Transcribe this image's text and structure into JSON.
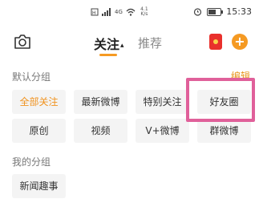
{
  "status_bar": {
    "network": "4G",
    "speed": "4.1",
    "speed_unit": "K/s",
    "time": "15:33"
  },
  "header": {
    "tab_follow": "关注",
    "tab_recommend": "推荐"
  },
  "groups": {
    "default_label": "默认分组",
    "edit_label": "编辑",
    "default_chips": [
      "全部关注",
      "最新微博",
      "特别关注",
      "好友圈",
      "原创",
      "视频",
      "V+微博",
      "群微博"
    ],
    "my_label": "我的分组",
    "my_chips": [
      "新闻趣事"
    ]
  },
  "colors": {
    "accent": "#f59a23",
    "highlight_box": "#e0609a",
    "chip_bg": "#f4f4f4"
  }
}
